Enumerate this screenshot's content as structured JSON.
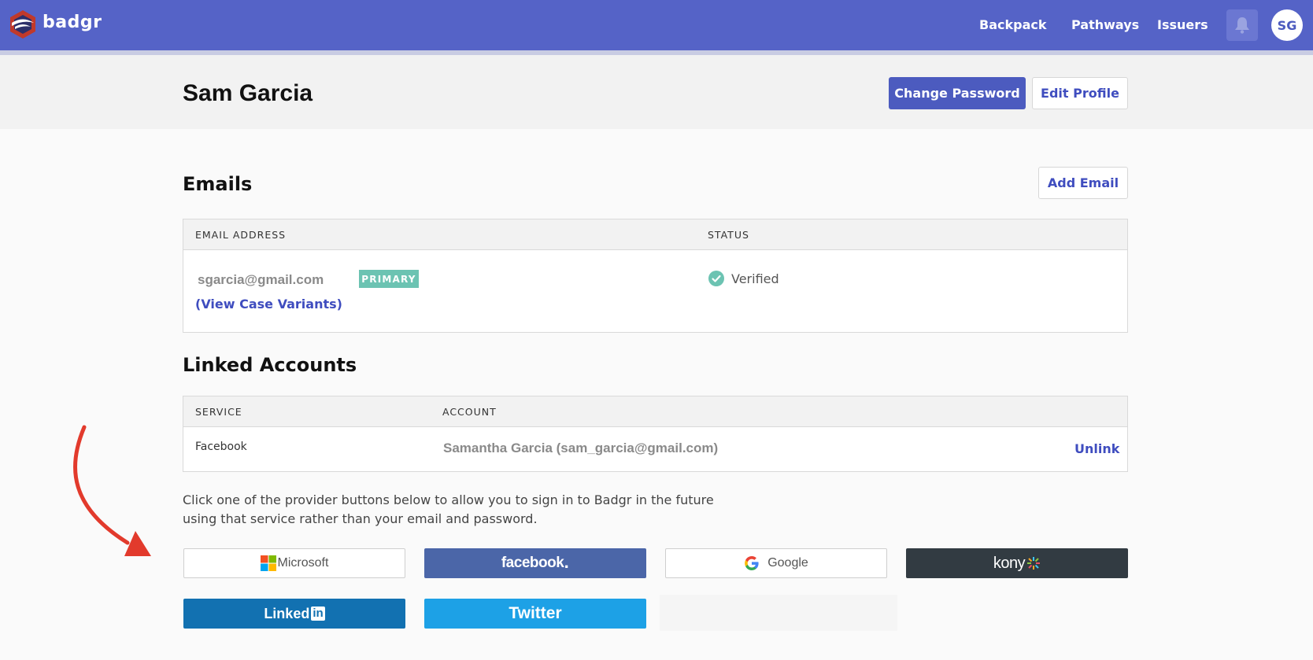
{
  "app": {
    "name": "badgr"
  },
  "nav": {
    "links": [
      "Backpack",
      "Pathways",
      "Issuers"
    ],
    "avatar_initials": "SG"
  },
  "profile": {
    "name": "Sam Garcia",
    "change_password_label": "Change Password",
    "edit_profile_label": "Edit Profile"
  },
  "emails": {
    "title": "Emails",
    "add_label": "Add Email",
    "columns": [
      "EMAIL ADDRESS",
      "STATUS"
    ],
    "rows": [
      {
        "address": "sgarcia@gmail.com",
        "badge": "PRIMARY",
        "variants_link": "(View Case Variants)",
        "status": "Verified"
      }
    ]
  },
  "linked": {
    "title": "Linked Accounts",
    "columns": [
      "SERVICE",
      "ACCOUNT"
    ],
    "rows": [
      {
        "service": "Facebook",
        "account": "Samantha Garcia (sam_garcia@gmail.com)",
        "action": "Unlink"
      }
    ]
  },
  "help_text": "Click one of the provider buttons below to allow you to sign in to Badgr in the future using that service rather than your email and password.",
  "providers": {
    "microsoft": "Microsoft",
    "facebook": "facebook",
    "google": "Google",
    "kony": "kony",
    "linkedin": "Linked",
    "linkedin_in": "in",
    "twitter": "Twitter"
  },
  "colors": {
    "brand": "#5563c7",
    "primary_button": "#4c5bbf",
    "badge": "#6cc3b2",
    "facebook": "#4b66a8",
    "kony": "#323b42",
    "linkedin": "#1271b1",
    "twitter": "#1da1e6",
    "annotation_arrow": "#e23a2c"
  },
  "icons": [
    "badgr-logo-icon",
    "bell-icon",
    "check-circle-icon",
    "microsoft-logo-icon",
    "google-logo-icon",
    "kony-spark-icon",
    "red-arrow-icon"
  ]
}
